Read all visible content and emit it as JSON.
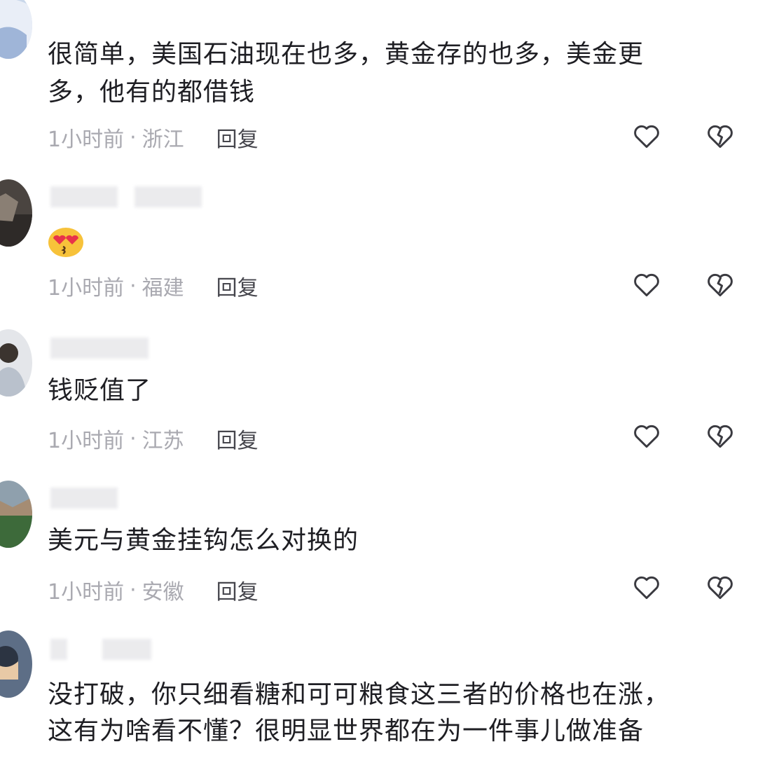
{
  "comments": [
    {
      "text": "很简单，美国石油现在也多，黄金存的也多，美金更多，他有的都借钱",
      "line1": "很简单，美国石油现在也多，黄金存的也多，美金更",
      "line2": "多，他有的都借钱",
      "time": "1小时前",
      "dot": "·",
      "location": "浙江",
      "reply": "回复"
    },
    {
      "emoji": "kissing-heart-eyes-emoji",
      "time": "1小时前",
      "dot": "·",
      "location": "福建",
      "reply": "回复"
    },
    {
      "text": "钱贬值了",
      "time": "1小时前",
      "dot": "·",
      "location": "江苏",
      "reply": "回复"
    },
    {
      "text": "美元与黄金挂钩怎么对换的",
      "time": "1小时前",
      "dot": "·",
      "location": "安徽",
      "reply": "回复"
    },
    {
      "line1": "没打破，你只细看糖和可可粮食这三者的价格也在涨，",
      "line2": "这有为啥看不懂？很明显世界都在为一件事儿做准备"
    }
  ],
  "icons": {
    "like": "heart-outline-icon",
    "dislike": "broken-heart-icon"
  },
  "colors": {
    "meta": "#a9a9b0",
    "reply": "#46464d",
    "icon": "#3a3a40"
  }
}
